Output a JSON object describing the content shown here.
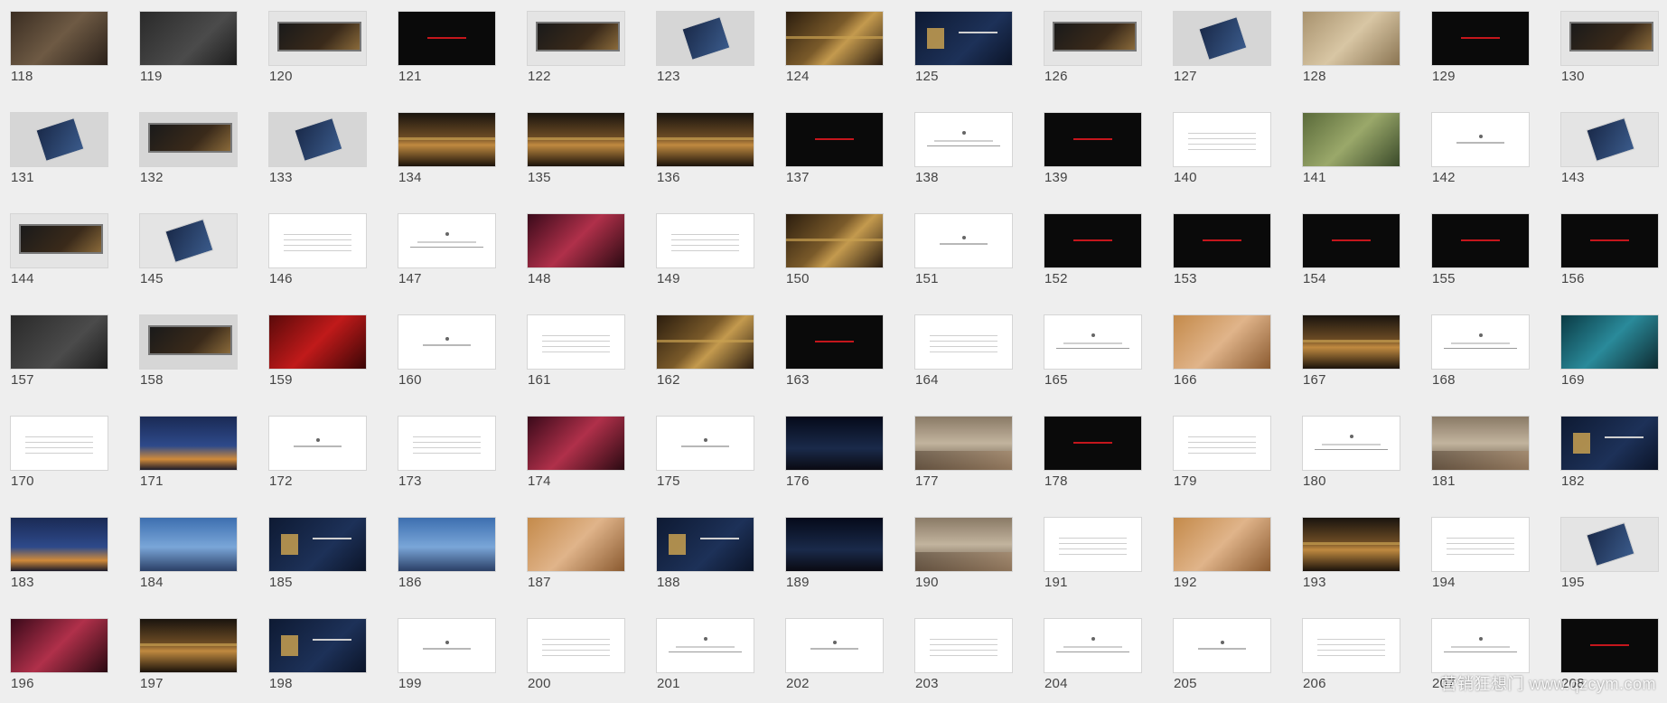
{
  "watermark": "营销狂想门 www.qzcym.com",
  "slides": [
    {
      "number": "118",
      "thumb": "brown"
    },
    {
      "number": "119",
      "thumb": "charcoal"
    },
    {
      "number": "120",
      "thumb": "lgrey"
    },
    {
      "number": "121",
      "thumb": "black"
    },
    {
      "number": "122",
      "thumb": "lgrey"
    },
    {
      "number": "123",
      "thumb": "grey"
    },
    {
      "number": "124",
      "thumb": "gold"
    },
    {
      "number": "125",
      "thumb": "navy"
    },
    {
      "number": "126",
      "thumb": "lgrey"
    },
    {
      "number": "127",
      "thumb": "grey"
    },
    {
      "number": "128",
      "thumb": "sand"
    },
    {
      "number": "129",
      "thumb": "black"
    },
    {
      "number": "130",
      "thumb": "lgrey"
    },
    {
      "number": "131",
      "thumb": "grey"
    },
    {
      "number": "132",
      "thumb": "grey"
    },
    {
      "number": "133",
      "thumb": "grey"
    },
    {
      "number": "134",
      "thumb": "hall"
    },
    {
      "number": "135",
      "thumb": "hall"
    },
    {
      "number": "136",
      "thumb": "hall"
    },
    {
      "number": "137",
      "thumb": "black"
    },
    {
      "number": "138",
      "thumb": "white"
    },
    {
      "number": "139",
      "thumb": "black"
    },
    {
      "number": "140",
      "thumb": "white"
    },
    {
      "number": "141",
      "thumb": "green"
    },
    {
      "number": "142",
      "thumb": "white"
    },
    {
      "number": "143",
      "thumb": "lgrey"
    },
    {
      "number": "144",
      "thumb": "lgrey"
    },
    {
      "number": "145",
      "thumb": "lgrey"
    },
    {
      "number": "146",
      "thumb": "white"
    },
    {
      "number": "147",
      "thumb": "white"
    },
    {
      "number": "148",
      "thumb": "party"
    },
    {
      "number": "149",
      "thumb": "white"
    },
    {
      "number": "150",
      "thumb": "gold"
    },
    {
      "number": "151",
      "thumb": "white"
    },
    {
      "number": "152",
      "thumb": "black"
    },
    {
      "number": "153",
      "thumb": "black"
    },
    {
      "number": "154",
      "thumb": "black"
    },
    {
      "number": "155",
      "thumb": "black"
    },
    {
      "number": "156",
      "thumb": "black"
    },
    {
      "number": "157",
      "thumb": "charcoal"
    },
    {
      "number": "158",
      "thumb": "grey"
    },
    {
      "number": "159",
      "thumb": "red"
    },
    {
      "number": "160",
      "thumb": "white"
    },
    {
      "number": "161",
      "thumb": "white"
    },
    {
      "number": "162",
      "thumb": "gold"
    },
    {
      "number": "163",
      "thumb": "black"
    },
    {
      "number": "164",
      "thumb": "white"
    },
    {
      "number": "165",
      "thumb": "white"
    },
    {
      "number": "166",
      "thumb": "warm"
    },
    {
      "number": "167",
      "thumb": "hall"
    },
    {
      "number": "168",
      "thumb": "white"
    },
    {
      "number": "169",
      "thumb": "teal"
    },
    {
      "number": "170",
      "thumb": "white"
    },
    {
      "number": "171",
      "thumb": "city"
    },
    {
      "number": "172",
      "thumb": "white"
    },
    {
      "number": "173",
      "thumb": "white"
    },
    {
      "number": "174",
      "thumb": "party"
    },
    {
      "number": "175",
      "thumb": "white"
    },
    {
      "number": "176",
      "thumb": "night"
    },
    {
      "number": "177",
      "thumb": "room"
    },
    {
      "number": "178",
      "thumb": "black"
    },
    {
      "number": "179",
      "thumb": "white"
    },
    {
      "number": "180",
      "thumb": "white"
    },
    {
      "number": "181",
      "thumb": "room"
    },
    {
      "number": "182",
      "thumb": "navy"
    },
    {
      "number": "183",
      "thumb": "city"
    },
    {
      "number": "184",
      "thumb": "blue"
    },
    {
      "number": "185",
      "thumb": "navy"
    },
    {
      "number": "186",
      "thumb": "blue"
    },
    {
      "number": "187",
      "thumb": "warm"
    },
    {
      "number": "188",
      "thumb": "navy"
    },
    {
      "number": "189",
      "thumb": "night"
    },
    {
      "number": "190",
      "thumb": "room"
    },
    {
      "number": "191",
      "thumb": "white"
    },
    {
      "number": "192",
      "thumb": "warm"
    },
    {
      "number": "193",
      "thumb": "hall"
    },
    {
      "number": "194",
      "thumb": "white"
    },
    {
      "number": "195",
      "thumb": "lgrey"
    },
    {
      "number": "196",
      "thumb": "party"
    },
    {
      "number": "197",
      "thumb": "hall"
    },
    {
      "number": "198",
      "thumb": "navy"
    },
    {
      "number": "199",
      "thumb": "white"
    },
    {
      "number": "200",
      "thumb": "white"
    },
    {
      "number": "201",
      "thumb": "white"
    },
    {
      "number": "202",
      "thumb": "white"
    },
    {
      "number": "203",
      "thumb": "white"
    },
    {
      "number": "204",
      "thumb": "white"
    },
    {
      "number": "205",
      "thumb": "white"
    },
    {
      "number": "206",
      "thumb": "white"
    },
    {
      "number": "207",
      "thumb": "white"
    },
    {
      "number": "208",
      "thumb": "black"
    }
  ]
}
